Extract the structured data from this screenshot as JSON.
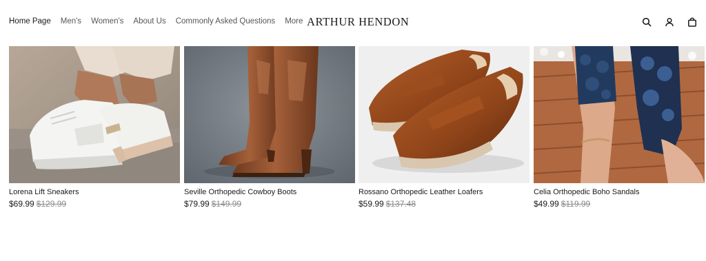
{
  "brand": "ARTHUR HENDON",
  "nav": {
    "items": [
      {
        "label": "Home Page",
        "active": true
      },
      {
        "label": "Men's",
        "active": false
      },
      {
        "label": "Women's",
        "active": false
      },
      {
        "label": "About Us",
        "active": false
      },
      {
        "label": "Commonly Asked Questions",
        "active": false
      },
      {
        "label": "More",
        "active": false
      }
    ]
  },
  "header_icons": [
    "search-icon",
    "account-icon",
    "cart-bag-icon"
  ],
  "products": [
    {
      "title": "Lorena Lift Sneakers",
      "price": "$69.99",
      "original_price": "$129.99"
    },
    {
      "title": "Seville Orthopedic Cowboy Boots",
      "price": "$79.99",
      "original_price": "$149.99"
    },
    {
      "title": "Rossano Orthopedic Leather Loafers",
      "price": "$59.99",
      "original_price": "$137.48"
    },
    {
      "title": "Celia Orthopedic Boho Sandals",
      "price": "$49.99",
      "original_price": "$119.99"
    }
  ],
  "colors": {
    "text": "#1a1a1a",
    "muted": "#8a8a8a",
    "background": "#ffffff"
  }
}
